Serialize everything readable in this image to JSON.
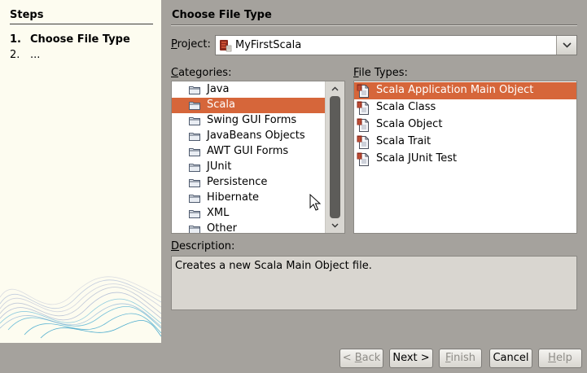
{
  "steps": {
    "title": "Steps",
    "items": [
      {
        "number": "1.",
        "label": "Choose File Type"
      },
      {
        "number": "2.",
        "label": "..."
      }
    ]
  },
  "page_title": "Choose File Type",
  "project": {
    "label_first": "P",
    "label_rest": "roject:",
    "value": "MyFirstScala"
  },
  "categories": {
    "label_first": "C",
    "label_rest": "ategories:",
    "selected_index": 1,
    "items": [
      "Java",
      "Scala",
      "Swing GUI Forms",
      "JavaBeans Objects",
      "AWT GUI Forms",
      "JUnit",
      "Persistence",
      "Hibernate",
      "XML",
      "Other"
    ]
  },
  "file_types": {
    "label_first": "F",
    "label_rest": "ile Types:",
    "selected_index": 0,
    "items": [
      "Scala Application Main Object",
      "Scala Class",
      "Scala Object",
      "Scala Trait",
      "Scala JUnit Test"
    ]
  },
  "description": {
    "label_first": "D",
    "label_rest": "escription:",
    "text": "Creates a new Scala Main Object file."
  },
  "buttons": {
    "back": {
      "prefix": "< ",
      "mnemonic": "B",
      "rest": "ack",
      "enabled": false
    },
    "next": {
      "label": "Next >",
      "enabled": true
    },
    "finish": {
      "mnemonic": "F",
      "rest": "inish",
      "enabled": false
    },
    "cancel": {
      "label": "Cancel",
      "enabled": true
    },
    "help": {
      "mnemonic": "H",
      "rest": "elp",
      "enabled": false
    }
  },
  "colors": {
    "selection": "#d6663a",
    "steps_background": "#fdfcf0",
    "window_background": "#a5a29d"
  },
  "icons": {
    "project": "scala-project-icon",
    "category": "folder-icon",
    "file_type": "scala-file-icon"
  }
}
